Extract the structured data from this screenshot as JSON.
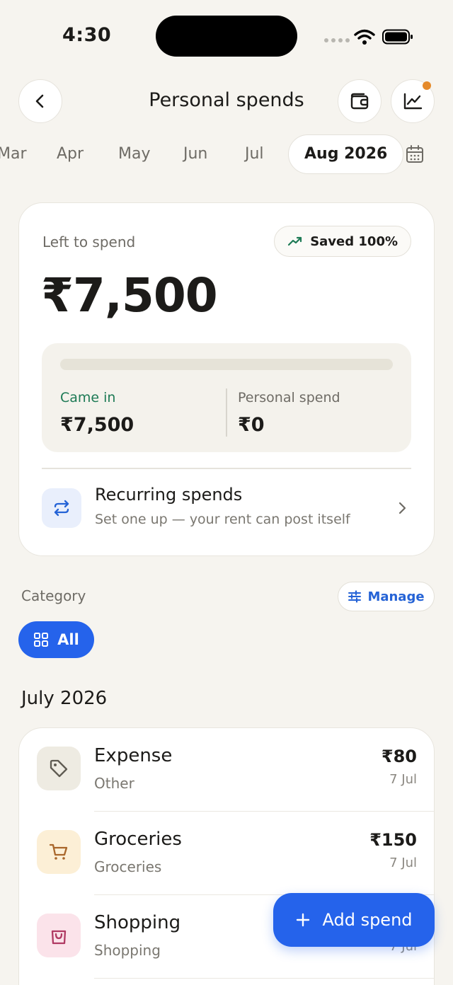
{
  "status_bar": {
    "time": "4:30"
  },
  "header": {
    "title": "Personal spends"
  },
  "months": {
    "tabs": [
      "Mar",
      "Apr",
      "May",
      "Jun",
      "Jul"
    ],
    "active": "Aug 2026"
  },
  "summary": {
    "left_label": "Left to spend",
    "saved_badge": "Saved 100%",
    "left_amount": "₹7,500",
    "spend_fraction": 0,
    "came_in_label": "Came in",
    "came_in_value": "₹7,500",
    "personal_spend_label": "Personal spend",
    "personal_spend_value": "₹0",
    "recurring_title": "Recurring spends",
    "recurring_subtitle": "Set one up — your rent can post itself"
  },
  "category": {
    "label": "Category",
    "manage_label": "Manage",
    "all_label": "All"
  },
  "transactions": {
    "heading": "July 2026",
    "items": [
      {
        "name": "Expense",
        "category": "Other",
        "amount": "₹80",
        "date": "7 Jul",
        "icon": "tag-icon",
        "icon_bg": "#eeebe2",
        "icon_color": "#5f5b52"
      },
      {
        "name": "Groceries",
        "category": "Groceries",
        "amount": "₹150",
        "date": "7 Jul",
        "icon": "cart-icon",
        "icon_bg": "#fcefd6",
        "icon_color": "#a9662a"
      },
      {
        "name": "Shopping",
        "category": "Shopping",
        "amount": "",
        "date": "7 Jul",
        "icon": "shopping-bag-icon",
        "icon_bg": "#fbe3ea",
        "icon_color": "#b03a63"
      }
    ]
  },
  "fab": {
    "label": "Add spend"
  },
  "colors": {
    "background": "#f6f4ef",
    "accent": "#2563eb",
    "positive": "#1d7a55",
    "notification": "#e58a2a"
  }
}
